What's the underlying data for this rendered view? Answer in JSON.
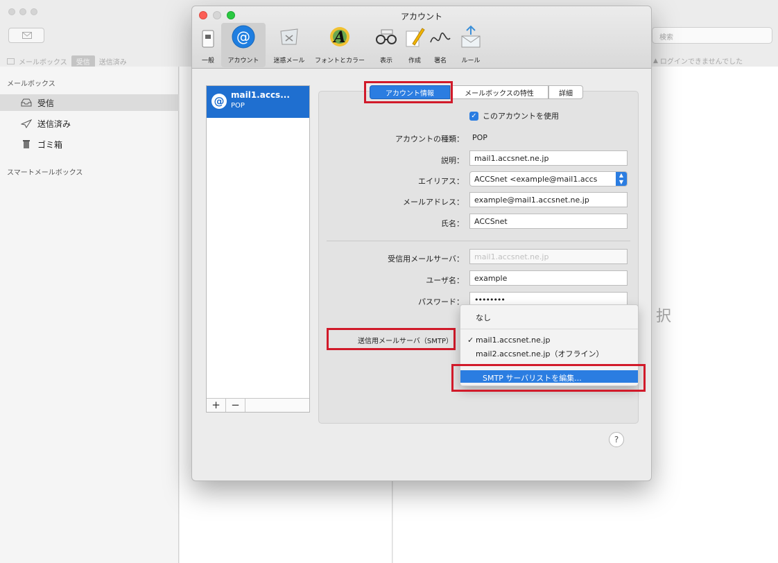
{
  "background_app": {
    "toolbar_left": [
      "メールボックス",
      "受信",
      "送信済み"
    ],
    "search_placeholder": "検索",
    "login_warning": "ログインできませんでした",
    "sidebar": {
      "section_title": "メールボックス",
      "items": [
        {
          "label": "受信",
          "icon": "inbox-icon"
        },
        {
          "label": "送信済み",
          "icon": "paper-plane-icon"
        },
        {
          "label": "ゴミ箱",
          "icon": "trash-icon"
        }
      ],
      "smart_title": "スマートメールボックス"
    },
    "viewer_partial_text": "択"
  },
  "window": {
    "title": "アカウント",
    "toolbar": [
      {
        "label": "一般",
        "icon": "switch-icon"
      },
      {
        "label": "アカウント",
        "icon": "at-icon",
        "selected": true
      },
      {
        "label": "迷惑メール",
        "icon": "junk-mail-icon"
      },
      {
        "label": "フォントとカラー",
        "icon": "fonts-colors-icon"
      },
      {
        "label": "表示",
        "icon": "glasses-icon"
      },
      {
        "label": "作成",
        "icon": "pencil-icon"
      },
      {
        "label": "署名",
        "icon": "signature-icon"
      },
      {
        "label": "ルール",
        "icon": "rules-icon"
      }
    ],
    "account": {
      "name": "mail1.accs...",
      "type": "POP"
    },
    "list_buttons": {
      "add": "+",
      "remove": "−"
    },
    "tabs": [
      "アカウント情報",
      "メールボックスの特性",
      "詳細"
    ],
    "use_account_checkbox": {
      "label": "このアカウントを使用",
      "checked": true
    },
    "fields": {
      "account_type": {
        "label": "アカウントの種類：",
        "value": "POP"
      },
      "description": {
        "label": "説明：",
        "value": "mail1.accsnet.ne.jp"
      },
      "alias": {
        "label": "エイリアス：",
        "value": "ACCSnet <example@mail1.accs"
      },
      "email": {
        "label": "メールアドレス：",
        "value": "example@mail1.accsnet.ne.jp"
      },
      "full_name": {
        "label": "氏名：",
        "value": "ACCSnet"
      },
      "incoming_server": {
        "label": "受信用メールサーバ：",
        "value": "mail1.accsnet.ne.jp"
      },
      "username": {
        "label": "ユーザ名：",
        "value": "example"
      },
      "password": {
        "label": "パスワード：",
        "value": "••••••••"
      },
      "smtp": {
        "label": "送信用メールサーバ（SMTP）"
      }
    },
    "smtp_menu": {
      "items": [
        "なし",
        "mail1.accsnet.ne.jp",
        "mail2.accsnet.ne.jp（オフライン）"
      ],
      "checked_index": 1,
      "edit_item": "SMTP サーバリストを編集..."
    },
    "help_button": "?"
  },
  "colors": {
    "highlight": "#d11a2a",
    "accent_blue": "#1f6fd0"
  }
}
